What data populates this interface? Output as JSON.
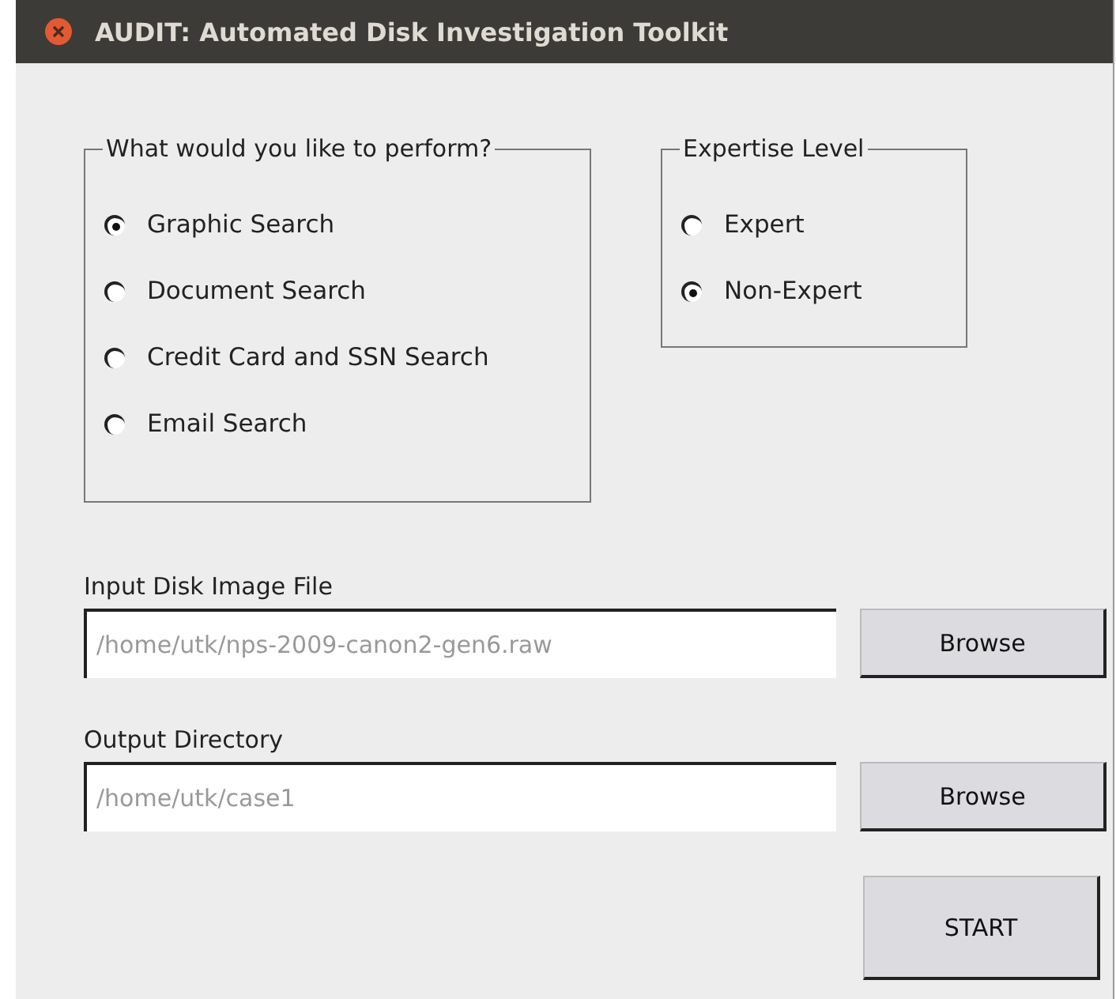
{
  "window": {
    "title": "AUDIT: Automated Disk Investigation Toolkit"
  },
  "task_group": {
    "title": "What would you like to perform?",
    "options": [
      {
        "label": "Graphic Search",
        "selected": true
      },
      {
        "label": "Document Search",
        "selected": false
      },
      {
        "label": "Credit Card and SSN Search",
        "selected": false
      },
      {
        "label": "Email Search",
        "selected": false
      }
    ]
  },
  "expertise_group": {
    "title": "Expertise Level",
    "options": [
      {
        "label": "Expert",
        "selected": false
      },
      {
        "label": "Non-Expert",
        "selected": true
      }
    ]
  },
  "paths": [
    {
      "label": "Input Disk Image File",
      "value": "/home/utk/nps-2009-canon2-gen6.raw",
      "button": "Browse"
    },
    {
      "label": "Output Directory",
      "value": "/home/utk/case1",
      "button": "Browse"
    }
  ],
  "start_button": "START"
}
